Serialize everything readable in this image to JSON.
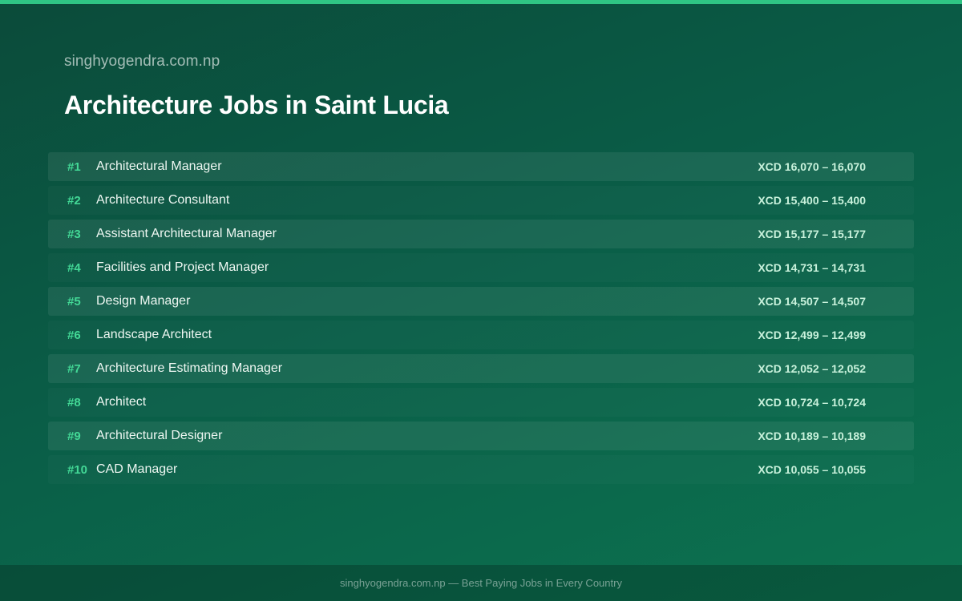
{
  "colors": {
    "accent": "#2fc584",
    "rank": "#43d896",
    "background_start": "#0b4b3a",
    "background_end": "#0c7350"
  },
  "site_name": "singhyogendra.com.np",
  "page_title": "Architecture Jobs in Saint Lucia",
  "jobs": [
    {
      "rank": "#1",
      "title": "Architectural Manager",
      "salary": "XCD 16,070 – 16,070"
    },
    {
      "rank": "#2",
      "title": "Architecture Consultant",
      "salary": "XCD 15,400 – 15,400"
    },
    {
      "rank": "#3",
      "title": "Assistant Architectural Manager",
      "salary": "XCD 15,177 – 15,177"
    },
    {
      "rank": "#4",
      "title": "Facilities and Project Manager",
      "salary": "XCD 14,731 – 14,731"
    },
    {
      "rank": "#5",
      "title": "Design Manager",
      "salary": "XCD 14,507 – 14,507"
    },
    {
      "rank": "#6",
      "title": "Landscape Architect",
      "salary": "XCD 12,499 – 12,499"
    },
    {
      "rank": "#7",
      "title": "Architecture Estimating Manager",
      "salary": "XCD 12,052 – 12,052"
    },
    {
      "rank": "#8",
      "title": "Architect",
      "salary": "XCD 10,724 – 10,724"
    },
    {
      "rank": "#9",
      "title": "Architectural Designer",
      "salary": "XCD 10,189 – 10,189"
    },
    {
      "rank": "#10",
      "title": "CAD Manager",
      "salary": "XCD 10,055 – 10,055"
    }
  ],
  "footer": {
    "text": "singhyogendra.com.np — Best Paying Jobs in Every Country"
  }
}
